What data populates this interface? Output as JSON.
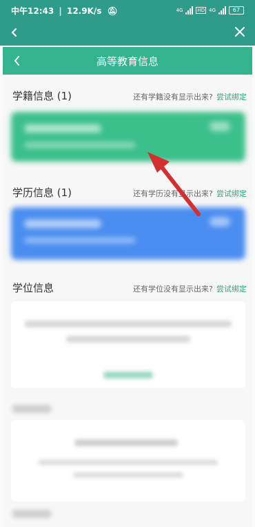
{
  "status_bar": {
    "time": "中午12:43",
    "separator": "|",
    "net_speed": "12.9K/s",
    "battery": "67",
    "net_label_1": "4G",
    "net_label_2": "4G"
  },
  "nav": {
    "title": "高等教育信息"
  },
  "sections": [
    {
      "title": "学籍信息 (1)",
      "hint": "还有学籍没有显示出来?",
      "link": "尝试绑定"
    },
    {
      "title": "学历信息 (1)",
      "hint": "还有学历没有显示出来?",
      "link": "尝试绑定"
    },
    {
      "title": "学位信息",
      "hint": "还有学位没有显示出来?",
      "link": "尝试绑定"
    }
  ],
  "colors": {
    "status_bg": "#2f9c8b",
    "appbar_bg": "#33b48f",
    "card_green": "#3bc08a",
    "card_blue": "#4a8df0",
    "link": "#2aa57f",
    "arrow": "#d32f2f"
  }
}
